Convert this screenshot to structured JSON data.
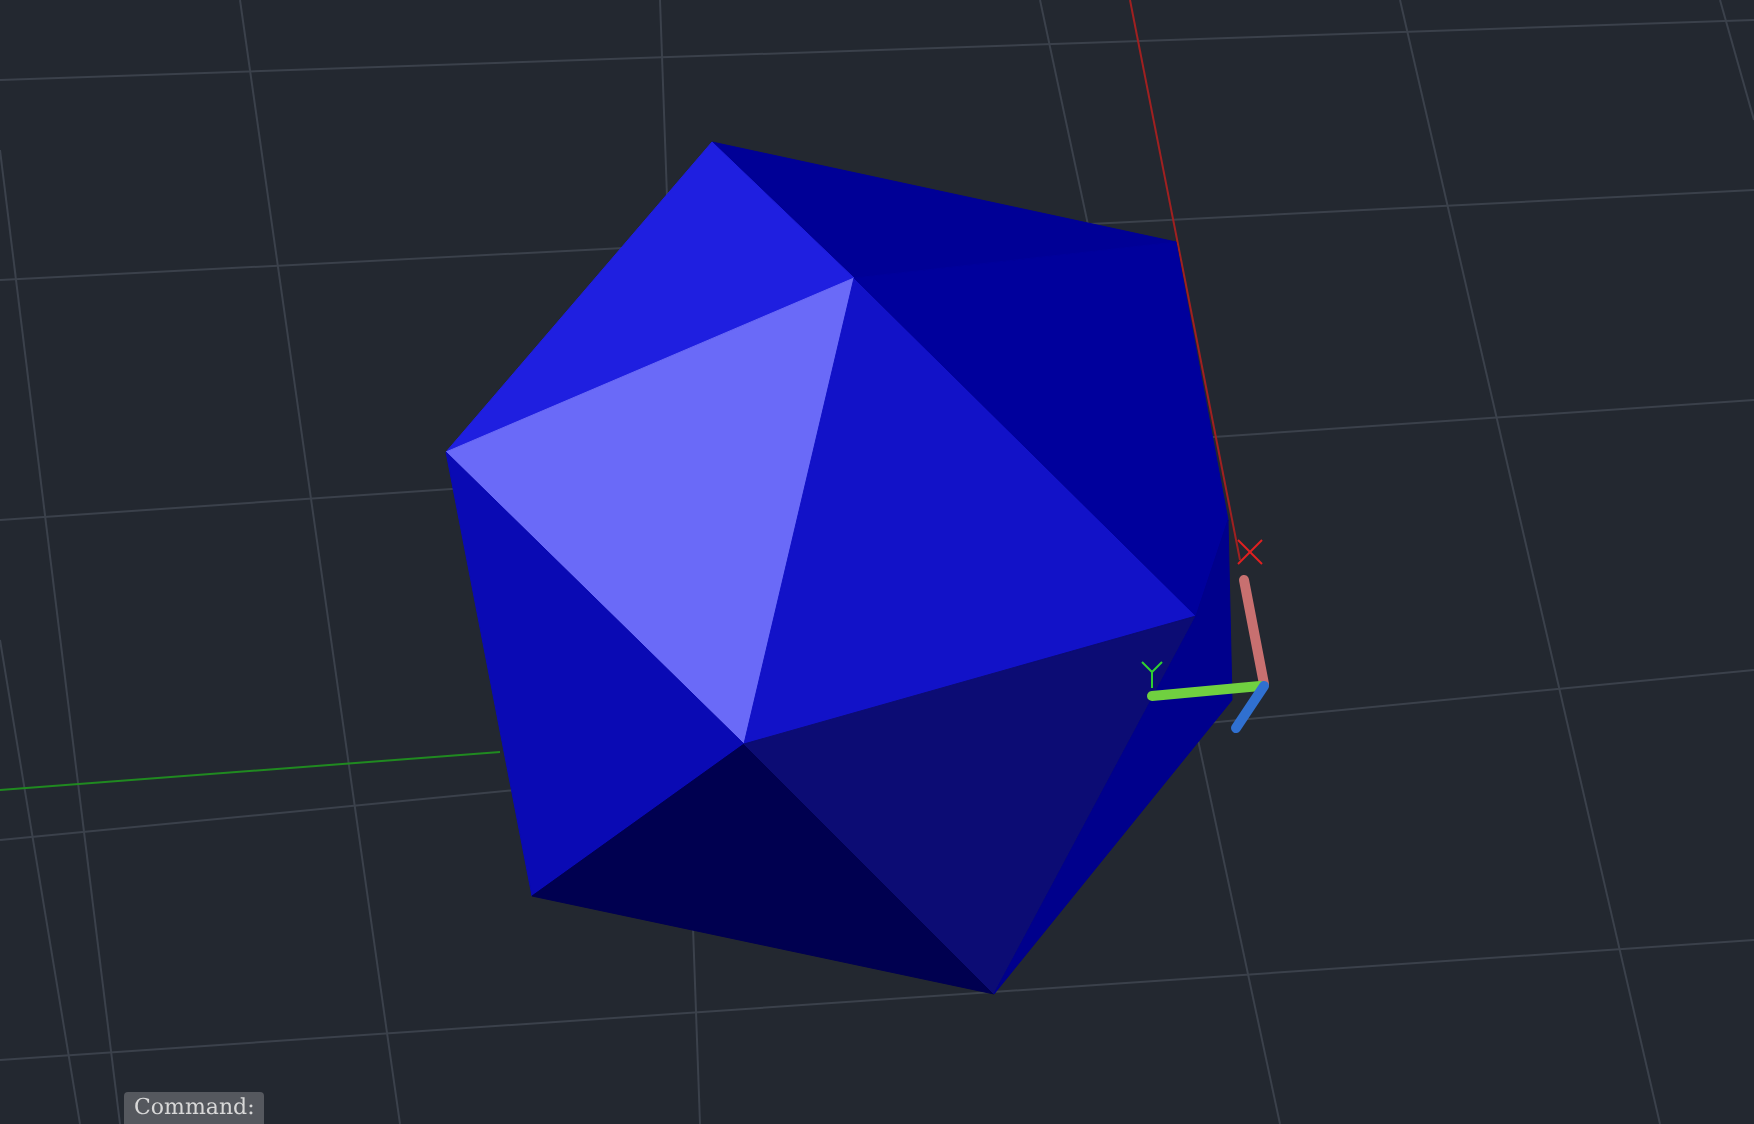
{
  "command_line": {
    "label": "Command:"
  }
}
